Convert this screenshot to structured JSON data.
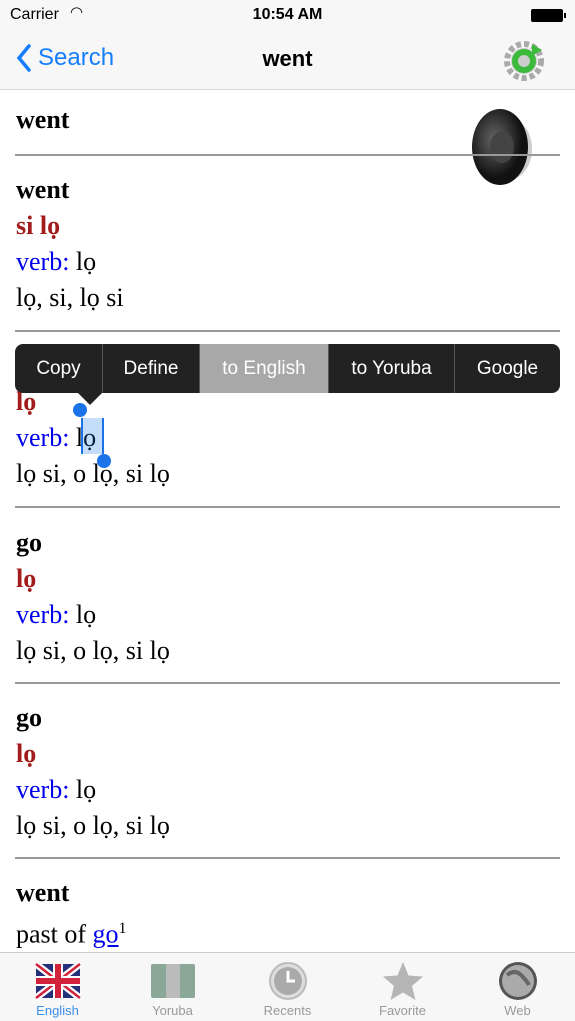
{
  "status": {
    "carrier": "Carrier",
    "time": "10:54 AM"
  },
  "nav": {
    "back_label": "Search",
    "title": "went"
  },
  "header_word": "went",
  "entries": [
    {
      "head": "went",
      "yoruba": "si lọ",
      "pos": "verb:",
      "pos_value": "lọ",
      "forms": "lọ, si, lọ si"
    },
    {
      "yoruba": "lọ",
      "pos": "verb:",
      "pos_value": "lọ",
      "forms": "lọ si, o lọ, si lọ"
    },
    {
      "head": "go",
      "yoruba": "lọ",
      "pos": "verb:",
      "pos_value": "lọ",
      "forms": "lọ si, o lọ, si lọ"
    },
    {
      "head": "go",
      "yoruba": "lọ",
      "pos": "verb:",
      "pos_value": "lọ",
      "forms": "lọ si, o lọ, si lọ"
    },
    {
      "head": "went",
      "text": "past of ",
      "link": "go",
      "sup": "1"
    }
  ],
  "context_menu": [
    "Copy",
    "Define",
    "to English",
    "to Yoruba",
    "Google"
  ],
  "context_menu_selected": "to English",
  "tabs": [
    {
      "label": "English",
      "icon": "uk-flag-icon",
      "active": true
    },
    {
      "label": "Yoruba",
      "icon": "nigeria-flag-icon"
    },
    {
      "label": "Recents",
      "icon": "clock-icon"
    },
    {
      "label": "Favorite",
      "icon": "star-icon"
    },
    {
      "label": "Web",
      "icon": "globe-icon"
    }
  ],
  "colors": {
    "accent": "#147efb",
    "yoruba_red": "#a31c1c",
    "pos_blue": "#0000ee"
  }
}
